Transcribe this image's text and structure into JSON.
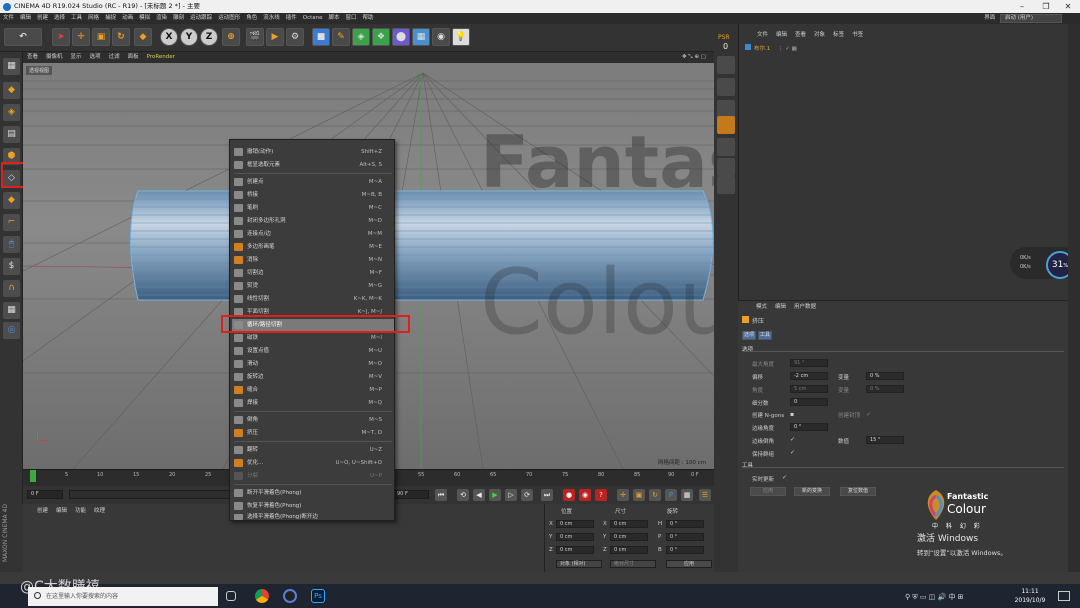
{
  "title": "CINEMA 4D R19.024 Studio (RC - R19) - [未标题 2 *] - 主要",
  "menubar": {
    "items": [
      "文件",
      "编辑",
      "创建",
      "选择",
      "工具",
      "网格",
      "捕捉",
      "动画",
      "模拟",
      "渲染",
      "雕刻",
      "运动跟踪",
      "运动图形",
      "角色",
      "流水线",
      "插件",
      "Octane",
      "脚本",
      "窗口",
      "帮助"
    ],
    "layout_label": "界面",
    "layout_value": "启动 (用户)"
  },
  "toolbar": {
    "axis_x": "X",
    "axis_y": "Y",
    "axis_z": "Z"
  },
  "viewport": {
    "menu": [
      "查看",
      "摄像机",
      "显示",
      "选项",
      "过滤",
      "面板",
      "ProRender"
    ],
    "label": "透视视图",
    "grid_spacing": "网格间距 : 100 cm"
  },
  "psr": {
    "label": "PSR",
    "value": "0"
  },
  "object_manager": {
    "menu": [
      "文件",
      "编辑",
      "查看",
      "对象",
      "标签",
      "书签"
    ],
    "object_name": "布尔.1"
  },
  "hud": {
    "percent": "31",
    "percent_unit": "%",
    "up": "0K/s",
    "down": "0K/s"
  },
  "context_menu": {
    "items": [
      {
        "label": "撤销(动作)",
        "shortcut": "Shift+Z",
        "disabled": false
      },
      {
        "label": "框显选取元素",
        "shortcut": "Alt+S, S",
        "disabled": false
      },
      {
        "label": "创建点",
        "shortcut": "M~A",
        "disabled": false
      },
      {
        "label": "桥接",
        "shortcut": "M~B, B",
        "disabled": false
      },
      {
        "label": "笔刷",
        "shortcut": "M~C",
        "disabled": false
      },
      {
        "label": "封闭多边形孔洞",
        "shortcut": "M~D",
        "disabled": false
      },
      {
        "label": "连接点/边",
        "shortcut": "M~M",
        "disabled": false
      },
      {
        "label": "多边形画笔",
        "shortcut": "M~E",
        "disabled": false
      },
      {
        "label": "消除",
        "shortcut": "M~N",
        "disabled": false
      },
      {
        "label": "切割边",
        "shortcut": "M~F",
        "disabled": false
      },
      {
        "label": "熨烫",
        "shortcut": "M~G",
        "disabled": false
      },
      {
        "label": "线性切割",
        "shortcut": "K~K, M~K",
        "disabled": false
      },
      {
        "label": "平面切割",
        "shortcut": "K~J, M~J",
        "disabled": false
      },
      {
        "label": "循环/路径切割",
        "shortcut": "",
        "disabled": false,
        "highlighted": true
      },
      {
        "label": "磁铁",
        "shortcut": "M~I",
        "disabled": false
      },
      {
        "label": "设置点值",
        "shortcut": "M~U",
        "disabled": false
      },
      {
        "label": "滑动",
        "shortcut": "M~O",
        "disabled": false
      },
      {
        "label": "旋转边",
        "shortcut": "M~V",
        "disabled": false
      },
      {
        "label": "缝合",
        "shortcut": "M~P",
        "disabled": false
      },
      {
        "label": "焊接",
        "shortcut": "M~Q",
        "disabled": false
      },
      {
        "label": "倒角",
        "shortcut": "M~S",
        "disabled": false
      },
      {
        "label": "挤压",
        "shortcut": "M~T, D",
        "disabled": false
      },
      {
        "label": "翻转",
        "shortcut": "U~Z",
        "disabled": false
      },
      {
        "label": "优化...",
        "shortcut": "U~O, U~Shift+O",
        "disabled": false
      },
      {
        "label": "分裂",
        "shortcut": "U~P",
        "disabled": true
      },
      {
        "label": "断开平滑着色(Phong)",
        "shortcut": "",
        "disabled": false
      },
      {
        "label": "恢复平滑着色(Phong)",
        "shortcut": "",
        "disabled": false
      },
      {
        "label": "选择平滑着色(Phong)断开边",
        "shortcut": "",
        "disabled": false
      }
    ]
  },
  "timeline": {
    "ticks": [
      "0",
      "5",
      "10",
      "15",
      "20",
      "25",
      "55",
      "60",
      "65",
      "70",
      "75",
      "80",
      "85",
      "90"
    ],
    "current_frame_label": "0 F",
    "start_field": "0 F",
    "end_field": "90 F",
    "min_field": "0 F"
  },
  "materials": {
    "menu": [
      "创建",
      "编辑",
      "功能",
      "纹理"
    ]
  },
  "coordinates": {
    "headers": [
      "位置",
      "尺寸",
      "旋转"
    ],
    "rows": [
      {
        "axis": "X",
        "pos": "0 cm",
        "size_axis": "X",
        "size": "0 cm",
        "rot_axis": "H",
        "rot": "0 °"
      },
      {
        "axis": "Y",
        "pos": "0 cm",
        "size_axis": "Y",
        "size": "0 cm",
        "rot_axis": "P",
        "rot": "0 °"
      },
      {
        "axis": "Z",
        "pos": "0 cm",
        "size_axis": "Z",
        "size": "0 cm",
        "rot_axis": "B",
        "rot": "0 °"
      }
    ],
    "mode": "对象 (相对)",
    "size_mode": "绝对尺寸",
    "apply": "应用"
  },
  "attributes": {
    "menu": [
      "模式",
      "编辑",
      "用户数据"
    ],
    "tool_title": "挤压",
    "tabs": [
      "选项",
      "工具"
    ],
    "section": "选项",
    "fields": [
      {
        "label": "最大角度",
        "value": "91 °"
      },
      {
        "label": "偏移",
        "value": "-2 cm"
      },
      {
        "label": "变量",
        "value": "0 %"
      },
      {
        "label": "角度",
        "value": "5 cm"
      },
      {
        "label": "变量",
        "value": "0 %"
      },
      {
        "label": "细分数",
        "value": "0"
      },
      {
        "label": "创建 N-gons",
        "value": ""
      },
      {
        "label": "创建封顶",
        "value": ""
      },
      {
        "label": "边缘角度",
        "value": "0 °"
      },
      {
        "label": "边缘倒角",
        "value": ""
      },
      {
        "label": "数值",
        "value": "15 °"
      },
      {
        "label": "保持群组",
        "value": ""
      }
    ],
    "tool_section": "工具",
    "realtime": "实时更新",
    "buttons": [
      "应用",
      "新的变换",
      "复位数值"
    ]
  },
  "watermark": {
    "fantastic": "Fantastic",
    "colour": "Colour",
    "cn": "中 科 幻 彩",
    "activate": "激活 Windows",
    "activate_hint": "转到“设置”以激活 Windows。",
    "bottom_left": "@C大数膳禧"
  },
  "taskbar": {
    "search_placeholder": "在这里输入你要搜索的内容",
    "time": "11:11",
    "date": "2019/10/9"
  },
  "maxon_label": "MAXON CINEMA 4D"
}
